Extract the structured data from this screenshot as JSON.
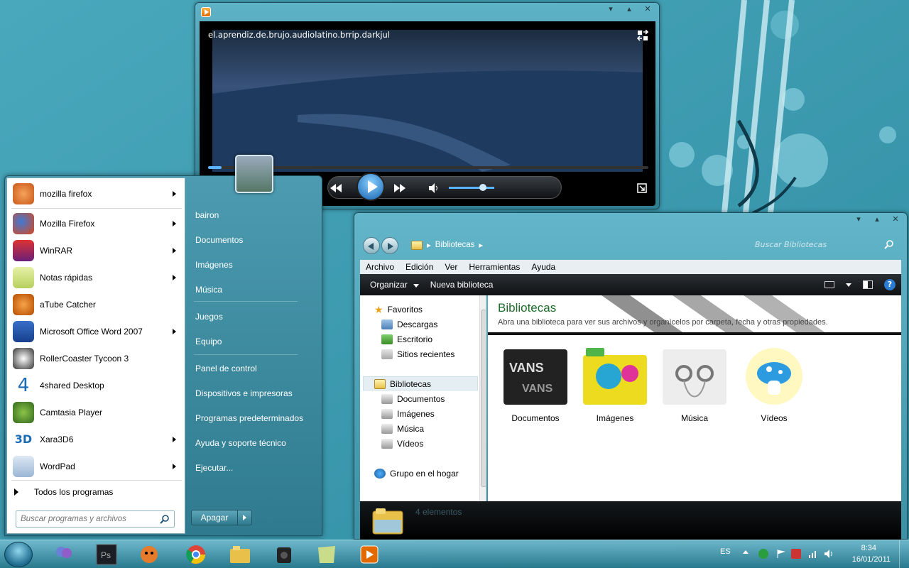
{
  "wallpaper": {},
  "media_player": {
    "title": "el.aprendiz.de.brujo.audiolatino.brrip.darkjul",
    "progress": 0.03,
    "volume": 0.75
  },
  "start_menu": {
    "programs": [
      {
        "label": "mozilla firefox",
        "icon": "firefox-fox-icon",
        "submenu": true
      },
      {
        "label": "Mozilla Firefox",
        "icon": "firefox-icon",
        "submenu": true
      },
      {
        "label": "WinRAR",
        "icon": "winrar-icon",
        "submenu": true
      },
      {
        "label": "Notas rápidas",
        "icon": "sticky-notes-icon",
        "submenu": true
      },
      {
        "label": "aTube Catcher",
        "icon": "atube-catcher-icon",
        "submenu": false
      },
      {
        "label": "Microsoft Office Word 2007",
        "icon": "word-icon",
        "submenu": true
      },
      {
        "label": "RollerCoaster Tycoon 3",
        "icon": "panda-icon",
        "submenu": false
      },
      {
        "label": "4shared Desktop",
        "icon": "4shared-icon",
        "submenu": false
      },
      {
        "label": "Camtasia Player",
        "icon": "camtasia-icon",
        "submenu": false
      },
      {
        "label": "Xara3D6",
        "icon": "xara3d-icon",
        "submenu": true
      },
      {
        "label": "WordPad",
        "icon": "wordpad-icon",
        "submenu": true
      }
    ],
    "all_programs": "Todos los programas",
    "search_placeholder": "Buscar programas y archivos",
    "right_items": [
      "bairon",
      "Documentos",
      "Imágenes",
      "Música",
      "Juegos",
      "Equipo",
      "Panel de control",
      "Dispositivos e impresoras",
      "Programas predeterminados",
      "Ayuda y soporte técnico",
      "Ejecutar..."
    ],
    "shutdown_label": "Apagar"
  },
  "explorer": {
    "address": "Bibliotecas",
    "search_placeholder": "Buscar Bibliotecas",
    "menu": [
      "Archivo",
      "Edición",
      "Ver",
      "Herramientas",
      "Ayuda"
    ],
    "command_organize": "Organizar",
    "command_new_library": "Nueva biblioteca",
    "nav": {
      "favorites": "Favoritos",
      "favorites_items": [
        "Descargas",
        "Escritorio",
        "Sitios recientes"
      ],
      "libraries": "Bibliotecas",
      "libraries_items": [
        "Documentos",
        "Imágenes",
        "Música",
        "Vídeos"
      ],
      "homegroup": "Grupo en el hogar"
    },
    "content_title": "Bibliotecas",
    "content_subtitle": "Abra una biblioteca para ver sus archivos y organícelos por carpeta, fecha y otras propiedades.",
    "libraries": [
      {
        "label": "Documentos",
        "icon": "vans-icon"
      },
      {
        "label": "Imágenes",
        "icon": "fav-folder-icon"
      },
      {
        "label": "Música",
        "icon": "earphones-icon"
      },
      {
        "label": "Vídeos",
        "icon": "mushroom-icon"
      }
    ],
    "details_count": "4 elementos"
  },
  "taskbar": {
    "language": "ES",
    "time": "8:34",
    "date": "16/01/2011"
  },
  "colors": {
    "desktop": "#3a98ad",
    "accent": "#2f7a8e"
  }
}
